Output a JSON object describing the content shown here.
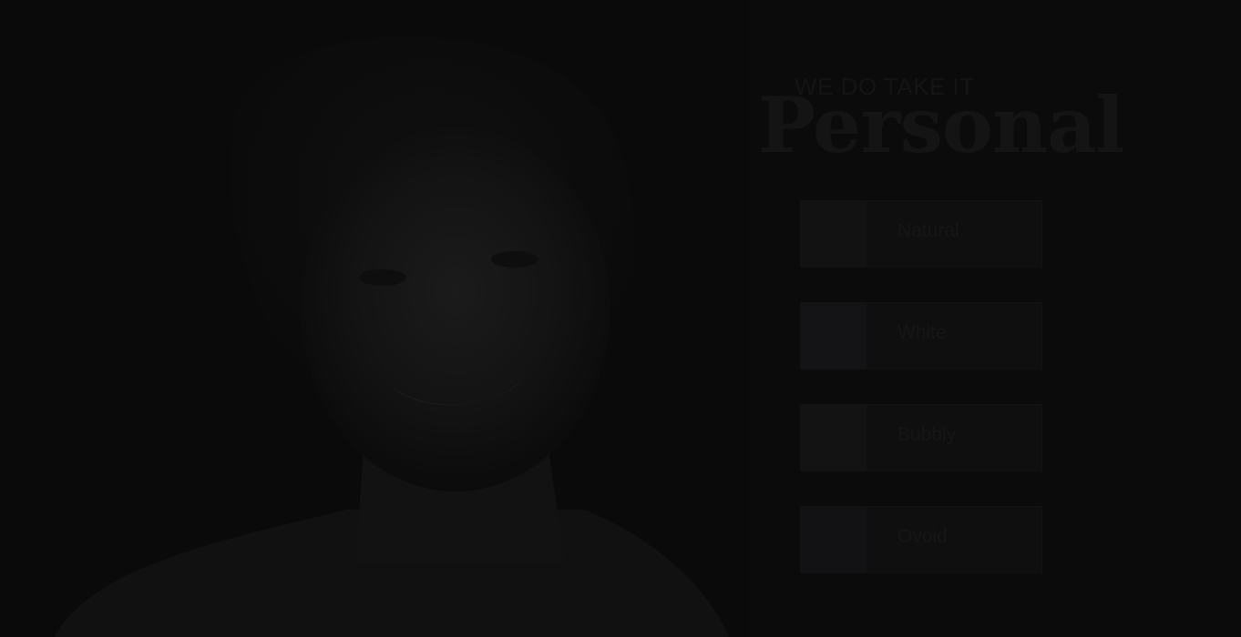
{
  "hero": {
    "eyebrow": "WE DO TAKE IT",
    "headline": "Personal"
  },
  "options": [
    {
      "label": "Natural",
      "swatch_color": "#121212"
    },
    {
      "label": "White",
      "swatch_color": "#141416"
    },
    {
      "label": "Bubbly",
      "swatch_color": "#131313"
    },
    {
      "label": "Ovoid",
      "swatch_color": "#121214"
    }
  ],
  "colors": {
    "background": "#0b0b0b",
    "text_dim": "#141414"
  }
}
